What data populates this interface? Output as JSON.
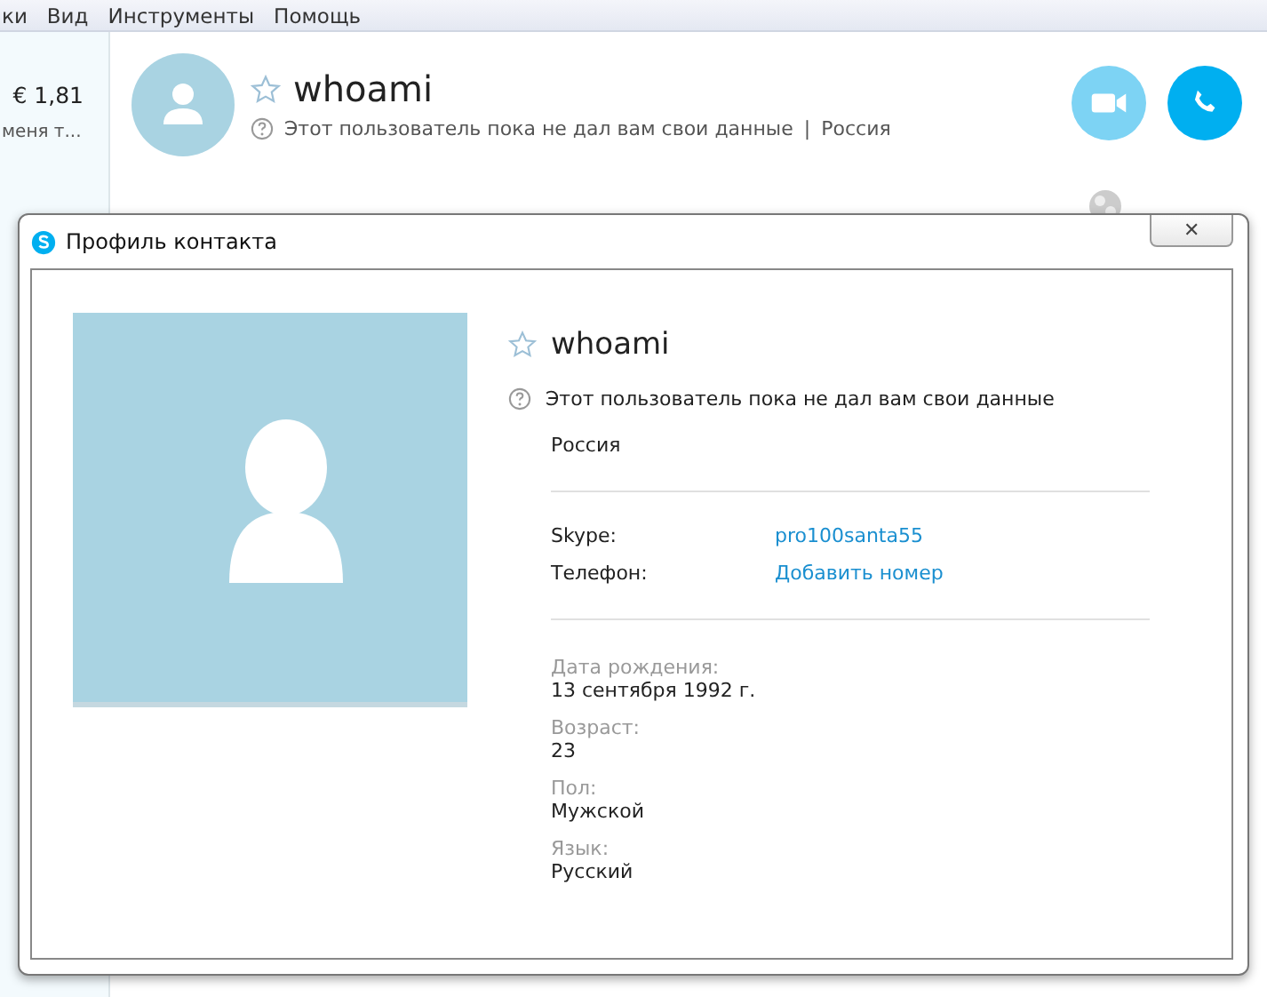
{
  "menu_bar": {
    "items": [
      "ки",
      "Вид",
      "Инструменты",
      "Помощь"
    ]
  },
  "sidebar": {
    "balance": "€ 1,81",
    "status": "меня т..."
  },
  "contact_header": {
    "name": "whoami",
    "favorite": false,
    "note": "Этот пользователь пока не дал вам свои данные",
    "separator": "|",
    "country": "Россия"
  },
  "dialog": {
    "title": "Профиль контакта",
    "close_label": "✕",
    "profile": {
      "name": "whoami",
      "favorite": false,
      "note": "Этот пользователь пока не дал вам свои данные",
      "country": "Россия",
      "contacts": [
        {
          "label": "Skype:",
          "value": "pro100santa55"
        },
        {
          "label": "Телефон:",
          "value": "Добавить номер"
        }
      ],
      "details": [
        {
          "label": "Дата рождения:",
          "value": "13 сентября 1992 г."
        },
        {
          "label": "Возраст:",
          "value": "23"
        },
        {
          "label": "Пол:",
          "value": "Мужской"
        },
        {
          "label": "Язык:",
          "value": "Русский"
        }
      ]
    }
  }
}
